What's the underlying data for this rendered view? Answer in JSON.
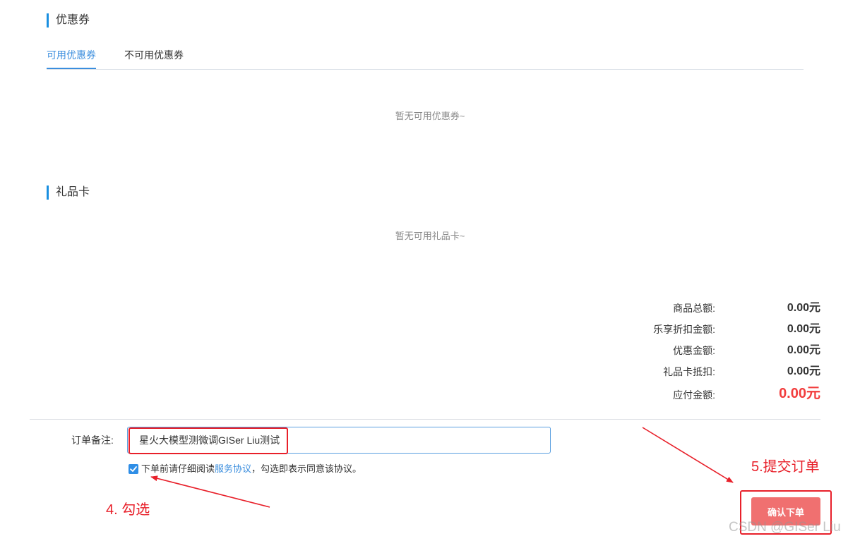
{
  "coupon": {
    "title": "优惠券",
    "tabs": [
      {
        "label": "可用优惠券",
        "active": true
      },
      {
        "label": "不可用优惠券",
        "active": false
      }
    ],
    "empty_text": "暂无可用优惠券~"
  },
  "gift_card": {
    "title": "礼品卡",
    "empty_text": "暂无可用礼品卡~"
  },
  "summary": {
    "rows": [
      {
        "label": "商品总额:",
        "value": "0.00元"
      },
      {
        "label": "乐享折扣金额:",
        "value": "0.00元"
      },
      {
        "label": "优惠金额:",
        "value": "0.00元"
      },
      {
        "label": "礼品卡抵扣:",
        "value": "0.00元"
      },
      {
        "label": "应付金额:",
        "value": "0.00元"
      }
    ]
  },
  "order": {
    "remark_label": "订单备注:",
    "remark_value": "星火大模型测微调GISer Liu测试",
    "agreement_checked": true,
    "agreement_prefix": "下单前请仔细阅读",
    "agreement_link": "服务协议",
    "agreement_suffix": "，勾选即表示同意该协议。",
    "submit_label": "确认下单"
  },
  "annotations": {
    "step4": "4. 勾选",
    "step5": "5.提交订单"
  },
  "watermark": "CSDN @GISer Liu",
  "colors": {
    "accent": "#3b8ede",
    "annotation_red": "#e8202a",
    "submit_bg": "#f07070",
    "total_red": "#f23d3d"
  }
}
